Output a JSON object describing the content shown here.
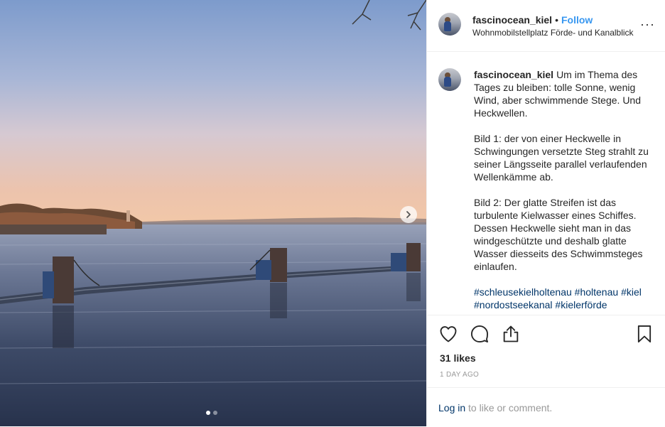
{
  "post": {
    "username": "fascinocean_kiel",
    "separator": "•",
    "follow_label": "Follow",
    "location": "Wohnmobilstellplatz Förde- und Kanalblick",
    "more_label": "···",
    "caption_username": "fascinocean_kiel",
    "caption_p1": "Um im Thema des Tages zu bleiben: tolle Sonne, wenig Wind, aber schwimmende Stege. Und Heckwellen.",
    "caption_p2": "Bild 1: der von einer Heckwelle in Schwingungen versetzte Steg strahlt zu seiner Längsseite parallel verlaufenden Wellenkämme ab.",
    "caption_p3": "Bild 2: Der glatte Streifen ist das turbulente Kielwasser eines Schiffes. Dessen Heckwelle sieht man in das windgeschützte und deshalb glatte Wasser diesseits des Schwimmsteges einlaufen.",
    "hashtags": [
      "#schleusekielholtenau",
      "#holtenau",
      "#kiel",
      "#nordostseekanal",
      "#kielerförde"
    ],
    "likes": "31 likes",
    "time_ago": "1 DAY AGO",
    "login_link": "Log in",
    "login_rest": " to like or comment."
  },
  "carousel": {
    "slide_count": 2,
    "active_index": 0
  },
  "icons": {
    "like": "heart-icon",
    "comment": "comment-icon",
    "share": "share-icon",
    "save": "bookmark-icon",
    "next": "chevron-right-icon"
  },
  "colors": {
    "link": "#3897f0",
    "hashtag": "#003569",
    "muted": "#999999",
    "text": "#262626",
    "border": "#efefef"
  }
}
